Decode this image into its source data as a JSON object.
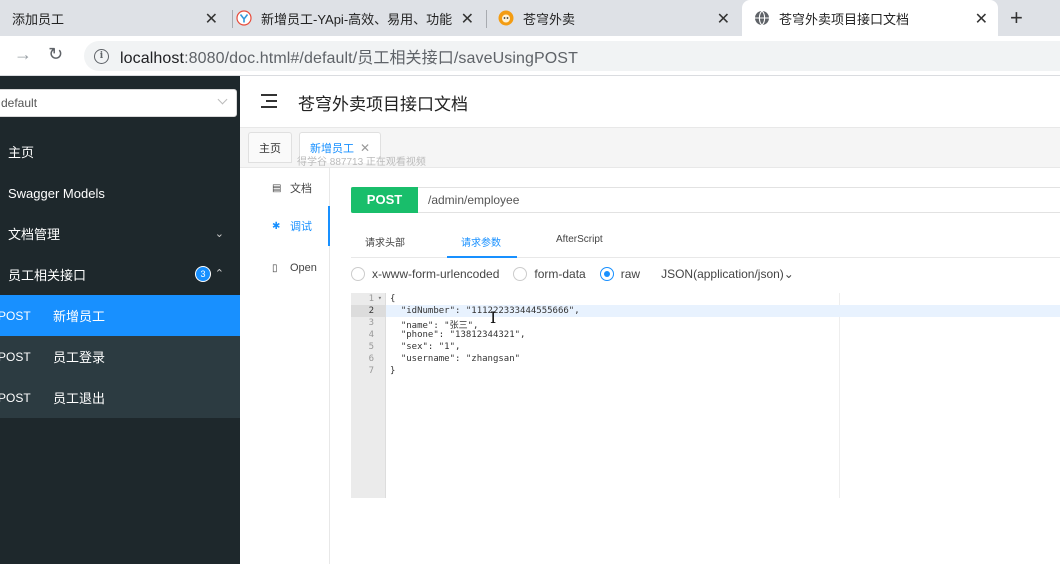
{
  "browser": {
    "tabs": [
      {
        "title": "添加员工"
      },
      {
        "title": "新增员工-YApi-高效、易用、功能"
      },
      {
        "title": "苍穹外卖"
      },
      {
        "title": "苍穹外卖项目接口文档"
      }
    ],
    "url_host": "localhost",
    "url_rest": ":8080/doc.html#/default/员工相关接口/saveUsingPOST",
    "new_tab": "+"
  },
  "sidebar": {
    "group": "default",
    "items": [
      {
        "label": "主页"
      },
      {
        "label": "Swagger Models"
      },
      {
        "label": "文档管理"
      },
      {
        "label": "员工相关接口",
        "count": "3"
      }
    ],
    "apis": [
      {
        "method": "POST",
        "name": "新增员工"
      },
      {
        "method": "POST",
        "name": "员工登录"
      },
      {
        "method": "POST",
        "name": "员工退出"
      }
    ]
  },
  "header": {
    "title": "苍穹外卖项目接口文档"
  },
  "doc_tabs": [
    {
      "label": "主页"
    },
    {
      "label": "新增员工"
    }
  ],
  "watermark": "得学谷 887713 正在观看视频",
  "side_tabs": [
    {
      "label": "文档"
    },
    {
      "label": "调试"
    },
    {
      "label": "Open"
    }
  ],
  "request": {
    "method": "POST",
    "path": "/admin/employee",
    "tabs": [
      "请求头部",
      "请求参数",
      "AfterScript"
    ],
    "body_types": [
      "x-www-form-urlencoded",
      "form-data",
      "raw"
    ],
    "content_type": "JSON(application/json)"
  },
  "editor": {
    "line_numbers": [
      "1",
      "2",
      "3",
      "4",
      "5",
      "6",
      "7"
    ],
    "lines": [
      "{",
      "  \"idNumber\": \"111222333444555666\",",
      "  \"name\": \"张三\",",
      "  \"phone\": \"13812344321\",",
      "  \"sex\": \"1\",",
      "  \"username\": \"zhangsan\"",
      "}"
    ]
  },
  "colors": {
    "accent": "#1890ff",
    "post": "#19be6b",
    "sidebar": "#1e282c"
  }
}
